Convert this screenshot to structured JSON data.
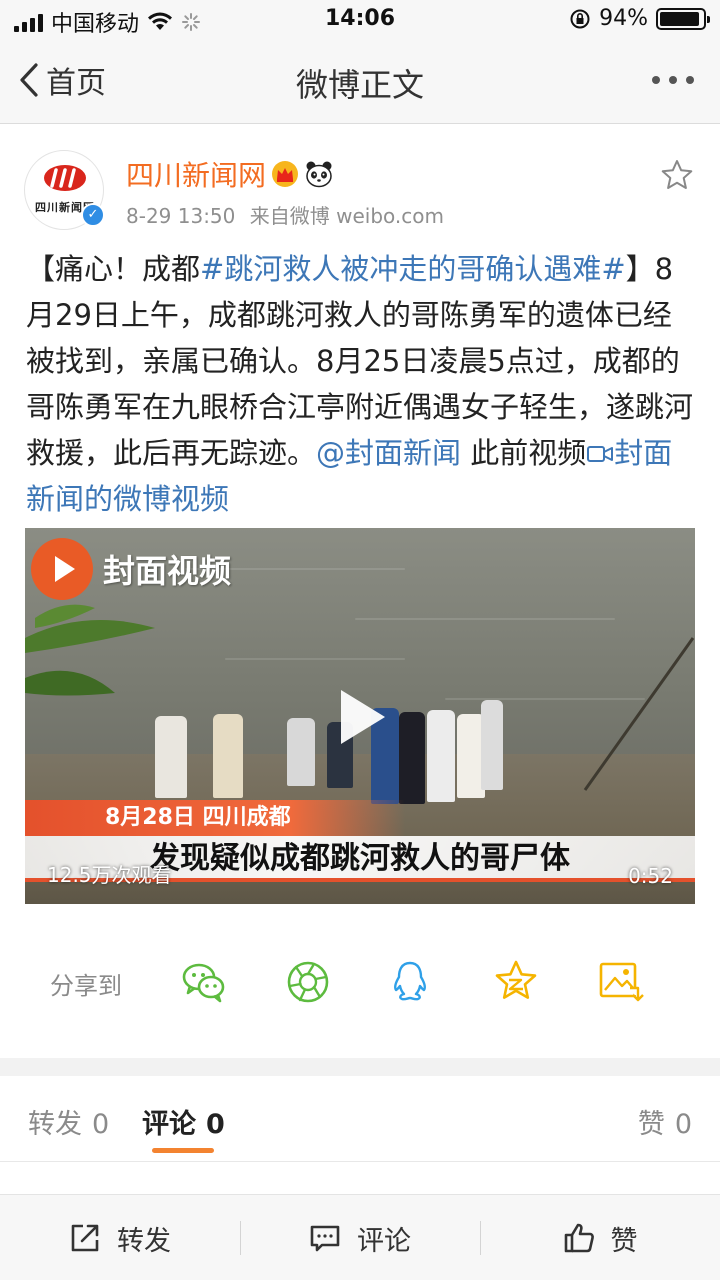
{
  "status_bar": {
    "carrier": "中国移动",
    "time": "14:06",
    "battery": "94%",
    "battery_level": 0.94
  },
  "nav": {
    "back_label": "首页",
    "title": "微博正文"
  },
  "post": {
    "author": "四川新闻网",
    "avatar_text": "四川新闻网",
    "verified_mark": "✓",
    "time": "8-29 13:50",
    "source": "来自微博 weibo.com",
    "text": {
      "p1": "【痛心！成都",
      "hashtag": "#跳河救人被冲走的哥确认遇难#",
      "p2": "】8月29日上午，成都跳河救人的哥陈勇军的遗体已经被找到，亲属已确认。8月25日凌晨5点过，成都的哥陈勇军在九眼桥合江亭附近偶遇女子轻生，遂跳河救援，此后再无踪迹。",
      "mention": "@封面新闻",
      "p3": " 此前视频",
      "video_link": "封面新闻的微博视频"
    }
  },
  "video": {
    "brand": "封面视频",
    "caption_tag": "8月28日  四川成都",
    "caption_main": "发现疑似成都跳河救人的哥尸体",
    "views": "12.5万次观看",
    "duration": "0:52"
  },
  "share": {
    "label": "分享到",
    "icons": [
      "wechat-icon",
      "moments-icon",
      "qq-icon",
      "qzone-icon",
      "save-image-icon"
    ]
  },
  "tabs": {
    "repost_label": "转发",
    "repost_count": "0",
    "comment_label": "评论",
    "comment_count": "0",
    "like_label": "赞",
    "like_count": "0"
  },
  "bottom_bar": {
    "repost": "转发",
    "comment": "评论",
    "like": "赞"
  },
  "colors": {
    "accent_orange": "#f36c21",
    "link_blue": "#3d77b7",
    "share_green": "#5dbb3f",
    "share_blue": "#2fa0e8",
    "share_yellow": "#f5b400"
  }
}
